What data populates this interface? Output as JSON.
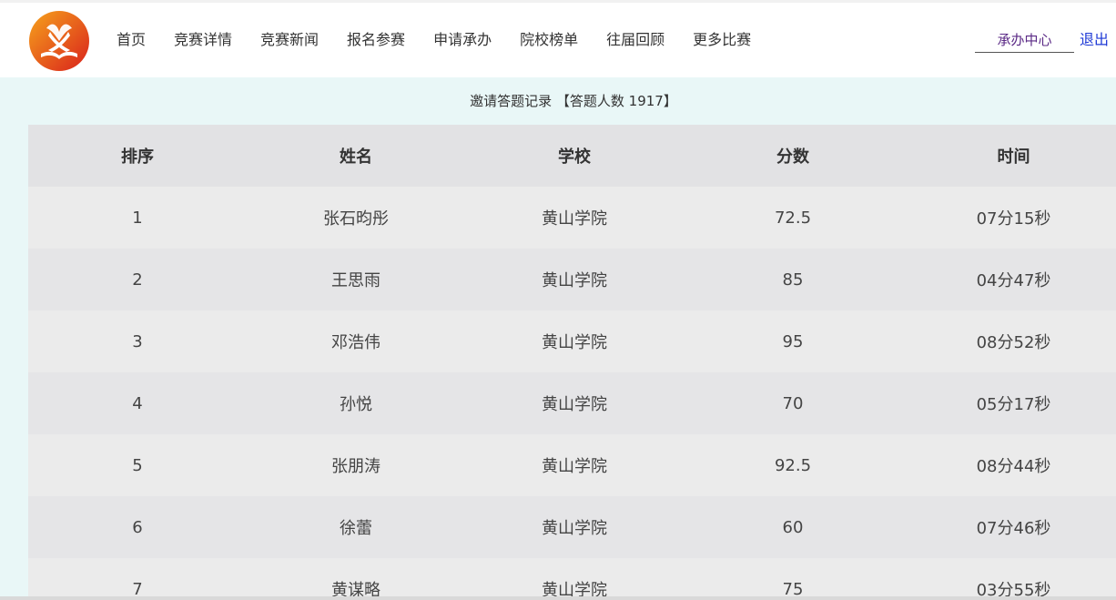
{
  "nav": {
    "items": [
      {
        "label": "首页",
        "name": "nav-home"
      },
      {
        "label": "竞赛详情",
        "name": "nav-contest-details"
      },
      {
        "label": "竞赛新闻",
        "name": "nav-contest-news"
      },
      {
        "label": "报名参赛",
        "name": "nav-register"
      },
      {
        "label": "申请承办",
        "name": "nav-apply-host"
      },
      {
        "label": "院校榜单",
        "name": "nav-school-ranking"
      },
      {
        "label": "往届回顾",
        "name": "nav-past-review"
      },
      {
        "label": "更多比赛",
        "name": "nav-more-contests"
      }
    ],
    "host_center": "承办中心",
    "logout": "退出"
  },
  "record": {
    "title": "邀请答题记录 【答题人数 1917】"
  },
  "table": {
    "headers": [
      "排序",
      "姓名",
      "学校",
      "分数",
      "时间"
    ],
    "rows": [
      [
        "1",
        "张石昀彤",
        "黄山学院",
        "72.5",
        "07分15秒"
      ],
      [
        "2",
        "王思雨",
        "黄山学院",
        "85",
        "04分47秒"
      ],
      [
        "3",
        "邓浩伟",
        "黄山学院",
        "95",
        "08分52秒"
      ],
      [
        "4",
        "孙悦",
        "黄山学院",
        "70",
        "05分17秒"
      ],
      [
        "5",
        "张朋涛",
        "黄山学院",
        "92.5",
        "08分44秒"
      ],
      [
        "6",
        "徐蕾",
        "黄山学院",
        "60",
        "07分46秒"
      ],
      [
        "7",
        "黄谋略",
        "黄山学院",
        "75",
        "03分55秒"
      ]
    ]
  },
  "colors": {
    "logo_gradient_start": "#f6a21c",
    "logo_gradient_end": "#d9211c",
    "main_background": "#e9f7f7",
    "header_row": "#e2e2e4",
    "logout_link": "#1f3ad6",
    "host_center_text": "#5b2a86"
  },
  "icons": {
    "logo": "contest-logo-icon"
  }
}
